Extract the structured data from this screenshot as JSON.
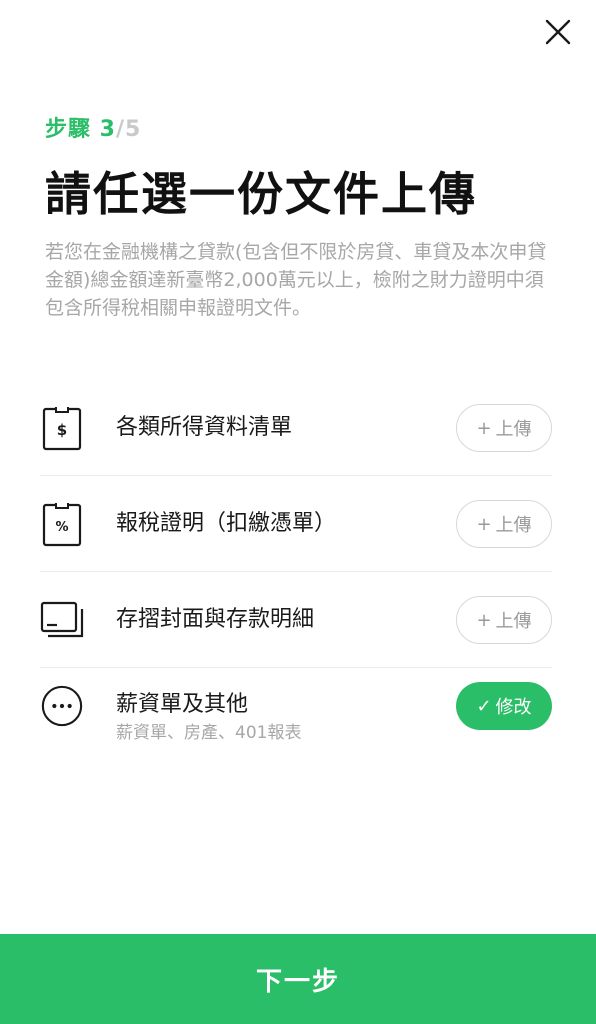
{
  "header": {
    "close_icon": "close-icon",
    "step_current": "步驟 3",
    "step_sep": "/",
    "step_total": "5",
    "title": "請任選一份文件上傳",
    "description": "若您在金融機構之貸款(包含但不限於房貸、車貸及本次申貸金額)總金額達新臺幣2,000萬元以上，檢附之財力證明中須包含所得稅相關申報證明文件。"
  },
  "documents": [
    {
      "label": "各類所得資料清單",
      "icon": "dollar-document-icon",
      "button_glyph": "+",
      "button_label": "上傳",
      "state": "upload"
    },
    {
      "label": "報稅證明（扣繳憑單）",
      "icon": "percent-document-icon",
      "button_glyph": "+",
      "button_label": "上傳",
      "state": "upload"
    },
    {
      "label": "存摺封面與存款明細",
      "icon": "passbook-icon",
      "button_glyph": "+",
      "button_label": "上傳",
      "state": "upload"
    },
    {
      "label": "薪資單及其他",
      "sublabel": "薪資單、房產、401報表",
      "icon": "more-icon",
      "button_glyph": "✓",
      "button_label": "修改",
      "state": "done"
    }
  ],
  "footer": {
    "next_label": "下一步"
  },
  "colors": {
    "accent": "#2bbe68",
    "muted": "#a7a7a7",
    "divider": "#ececec"
  }
}
